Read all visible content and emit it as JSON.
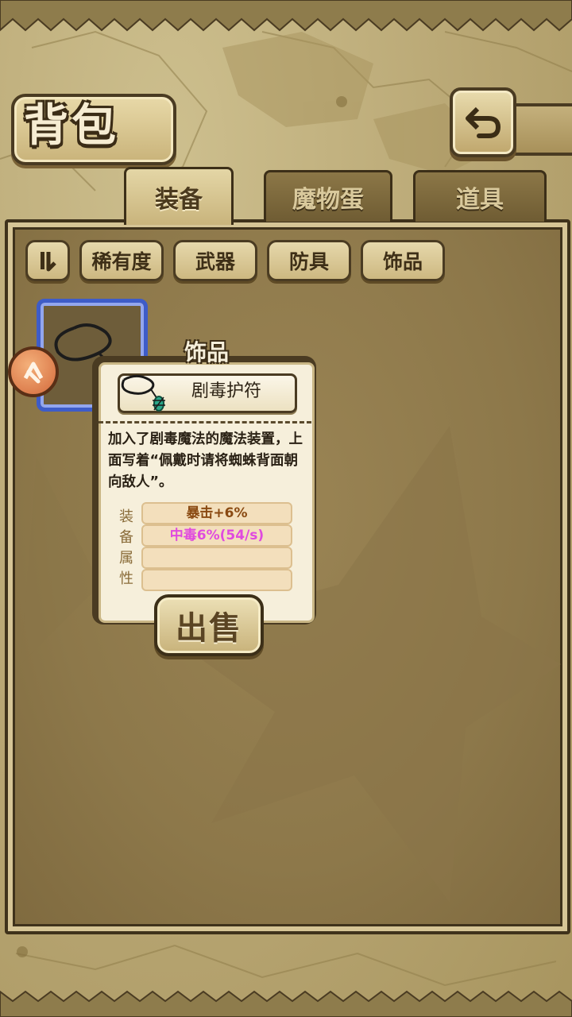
{
  "header": {
    "title": "背包",
    "back_icon": "back-arrow-icon"
  },
  "tabs": [
    {
      "label": "装备",
      "active": true
    },
    {
      "label": "魔物蛋",
      "active": false
    },
    {
      "label": "道具",
      "active": false
    }
  ],
  "filters": {
    "sort_icon": "sort-toggle-icon",
    "chips": [
      "稀有度",
      "武器",
      "防具",
      "饰品"
    ]
  },
  "selected_item": {
    "slot_border_color": "#3e5cc8",
    "badge_icon": "equip-marker-icon"
  },
  "popup": {
    "category": "饰品",
    "item_name": "剧毒护符",
    "item_icon": "amulet-icon",
    "description": "加入了剧毒魔法的魔法装置，上面写着“佩戴时请将蜘蛛背面朝向敌人”。",
    "attr_labels": [
      "装",
      "备",
      "属",
      "性"
    ],
    "attributes": [
      {
        "text": "暴击+6%",
        "color": "#8a4a12"
      },
      {
        "text": "中毒6%(54/s)",
        "color": "#e04adf"
      },
      {
        "text": "",
        "color": "#000000"
      },
      {
        "text": "",
        "color": "#000000"
      }
    ],
    "sell_label": "出售"
  }
}
